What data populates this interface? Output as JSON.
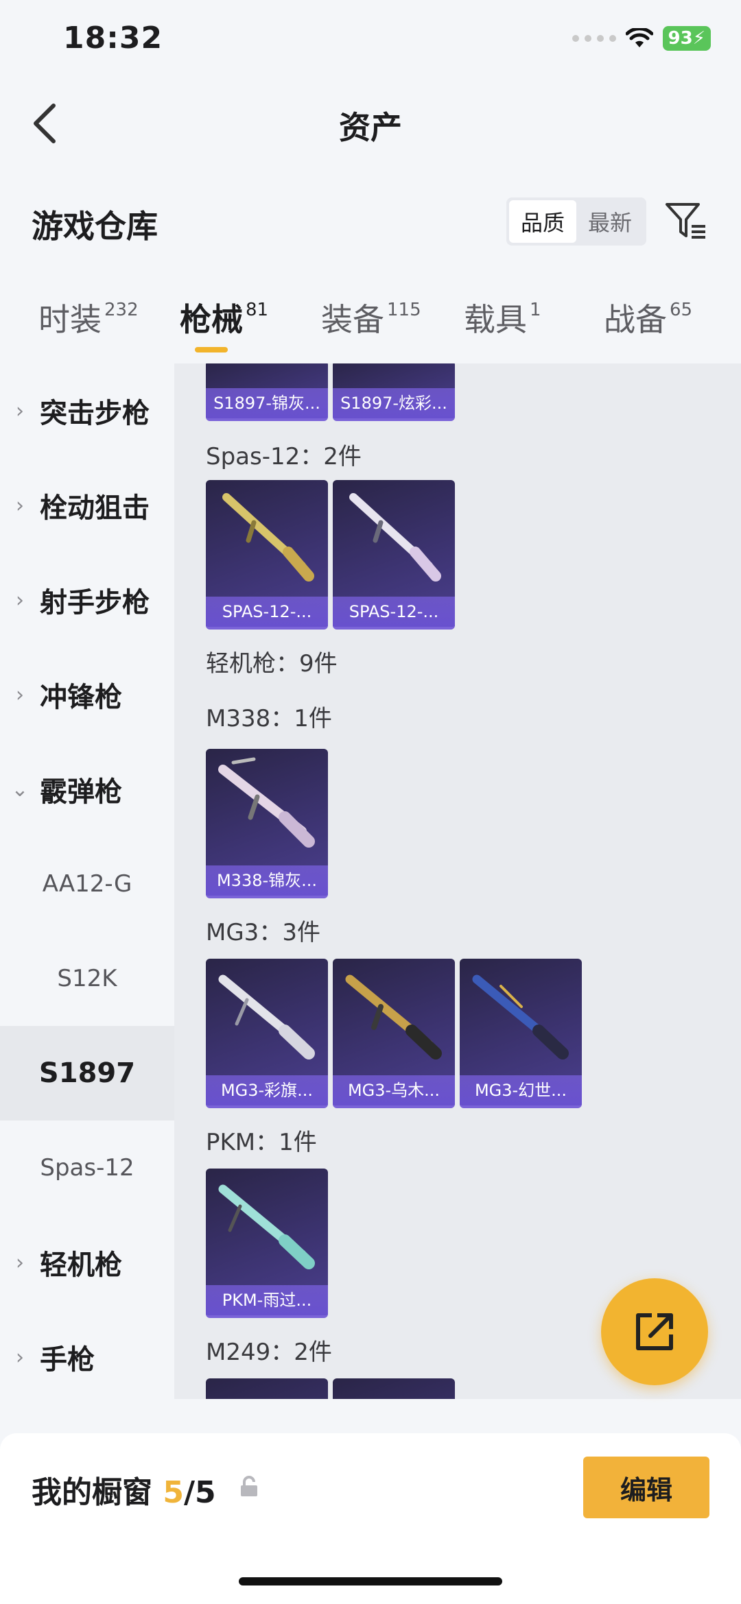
{
  "status": {
    "time": "18:32",
    "battery": "93"
  },
  "nav": {
    "title": "资产"
  },
  "warehouse": {
    "title": "游戏仓库",
    "sort": {
      "quality": "品质",
      "latest": "最新"
    }
  },
  "tabs": [
    {
      "label": "时装",
      "count": "232"
    },
    {
      "label": "枪械",
      "count": "81"
    },
    {
      "label": "装备",
      "count": "115"
    },
    {
      "label": "载具",
      "count": "1"
    },
    {
      "label": "战备",
      "count": "65"
    }
  ],
  "sidebar": {
    "categories": [
      "突击步枪",
      "栓动狙击",
      "射手步枪",
      "冲锋枪",
      "霰弹枪"
    ],
    "shotgun_subs": [
      "AA12-G",
      "S12K",
      "S1897",
      "Spas-12"
    ],
    "more": [
      "轻机枪",
      "手枪"
    ]
  },
  "content": {
    "top_cards": [
      "S1897-锦灰...",
      "S1897-炫彩..."
    ],
    "spas_label": "Spas-12：2件",
    "spas_cards": [
      "SPAS-12-...",
      "SPAS-12-..."
    ],
    "lmg_label": "轻机枪：9件",
    "m338_label": "M338：1件",
    "m338_cards": [
      "M338-锦灰..."
    ],
    "mg3_label": "MG3：3件",
    "mg3_cards": [
      "MG3-彩旗...",
      "MG3-乌木...",
      "MG3-幻世..."
    ],
    "pkm_label": "PKM：1件",
    "pkm_cards": [
      "PKM-雨过..."
    ],
    "m249_label": "M249：2件"
  },
  "bottom": {
    "showcase_label": "我的橱窗",
    "showcase_current": "5",
    "showcase_total": "/5",
    "edit": "编辑"
  },
  "colors": {
    "accent": "#f2b42c",
    "card_purple": "#4b3f8f"
  }
}
